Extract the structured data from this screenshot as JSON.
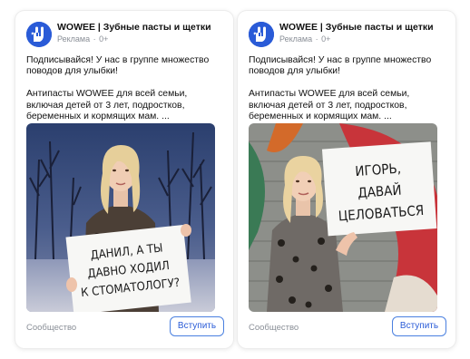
{
  "colors": {
    "brand_blue": "#2a5bd7",
    "muted": "#8a8f97",
    "button_border": "#4a80e0"
  },
  "cards": [
    {
      "brand_name": "WOWEE | Зубные пасты и щетки",
      "ad_label": "Реклама",
      "age_rating": "0+",
      "text_line1": "Подписывайся! У нас в группе множество поводов для улыбки!",
      "text_line2": "Антипасты WOWEE для всей семьи, включая детей от 3 лет, подростков, беременных и кормящих мам. ...",
      "sign_lines": [
        "ДАНИЛ, А ТЫ",
        "ДАВНО ХОДИЛ",
        "К СТОМАТОЛОГУ?"
      ],
      "footer_label": "Сообщество",
      "join_label": "Вступить",
      "logo_icon": "rock-hand-icon"
    },
    {
      "brand_name": "WOWEE | Зубные пасты и щетки",
      "ad_label": "Реклама",
      "age_rating": "0+",
      "text_line1": "Подписывайся! У нас в группе множество поводов для улыбки!",
      "text_line2": "Антипасты WOWEE для всей семьи, включая детей от 3 лет, подростков, беременных и кормящих мам. ...",
      "sign_lines": [
        "ИГОРЬ,",
        "ДАВАЙ",
        "ЦЕЛОВАТЬСЯ"
      ],
      "footer_label": "Сообщество",
      "join_label": "Вступить",
      "logo_icon": "rock-hand-icon"
    }
  ]
}
